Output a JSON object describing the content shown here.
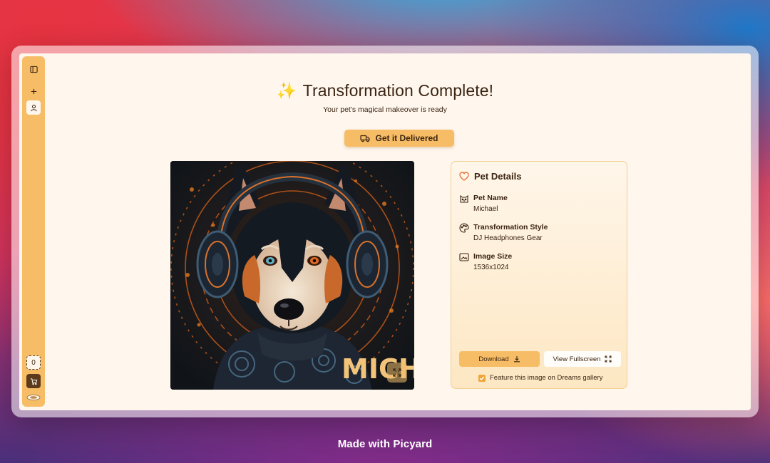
{
  "sidebar": {
    "toggle_icon": "sidebar-panel-icon",
    "add_icon": "plus-icon",
    "profile_icon": "user-icon",
    "cart_count": "0",
    "cart_icon": "cart-icon",
    "logo_icon": "picyard-logo-icon"
  },
  "header": {
    "title_icon": "✨",
    "title": "Transformation Complete!",
    "subtitle": "Your pet's magical makeover is ready"
  },
  "deliver_button": {
    "label": "Get it Delivered",
    "icon": "truck-icon"
  },
  "image": {
    "overlay_text": "MICHA",
    "expand_icon": "expand-icon"
  },
  "details": {
    "title": "Pet Details",
    "title_icon": "heart-icon",
    "fields": [
      {
        "label": "Pet Name",
        "value": "Michael",
        "icon": "cat-icon"
      },
      {
        "label": "Transformation Style",
        "value": "DJ Headphones Gear",
        "icon": "palette-icon"
      },
      {
        "label": "Image Size",
        "value": "1536x1024",
        "icon": "image-icon"
      }
    ],
    "download_label": "Download",
    "fullscreen_label": "View Fullscreen",
    "feature_label": "Feature this image on Dreams gallery",
    "feature_checked": true
  },
  "footer": {
    "made_with": "Made with Picyard"
  },
  "colors": {
    "accent": "#f7bd66",
    "text": "#3a2412",
    "background": "#fff7ee",
    "border": "#f1cf91"
  }
}
